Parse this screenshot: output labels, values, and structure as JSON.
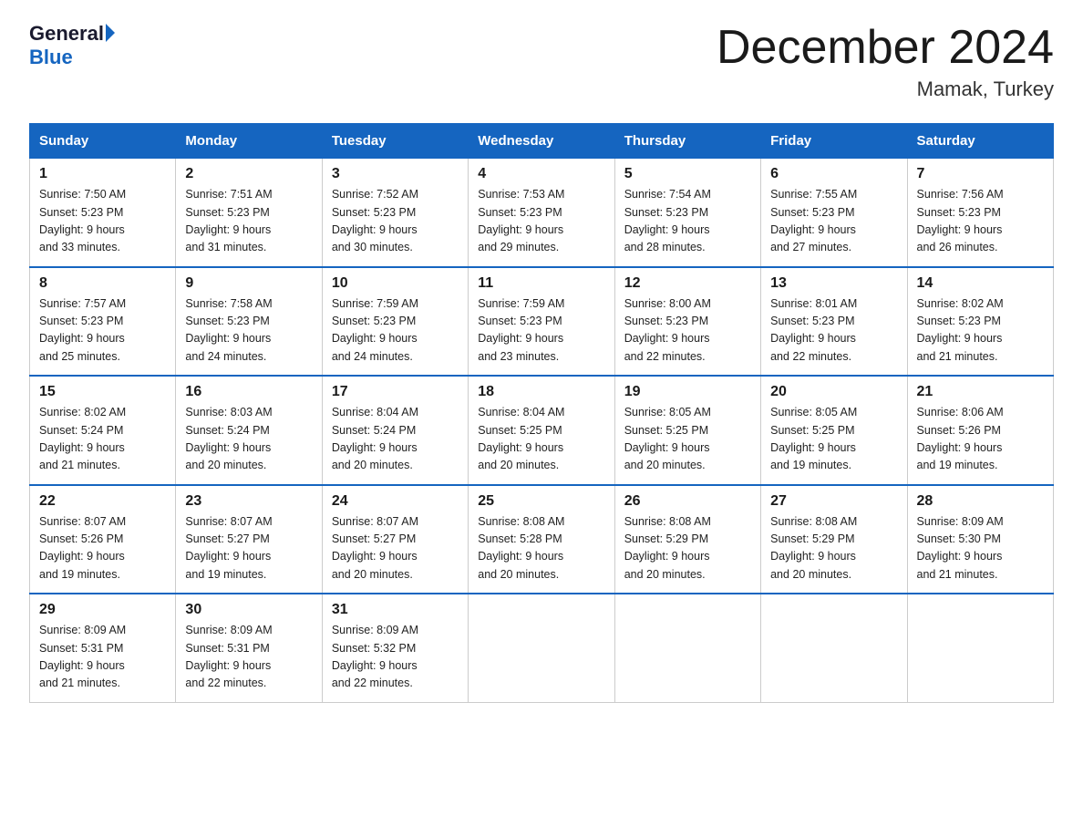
{
  "logo": {
    "line1": "General",
    "line2": "Blue"
  },
  "title": "December 2024",
  "subtitle": "Mamak, Turkey",
  "days_of_week": [
    "Sunday",
    "Monday",
    "Tuesday",
    "Wednesday",
    "Thursday",
    "Friday",
    "Saturday"
  ],
  "weeks": [
    [
      {
        "day": "1",
        "sunrise": "7:50 AM",
        "sunset": "5:23 PM",
        "daylight": "9 hours and 33 minutes."
      },
      {
        "day": "2",
        "sunrise": "7:51 AM",
        "sunset": "5:23 PM",
        "daylight": "9 hours and 31 minutes."
      },
      {
        "day": "3",
        "sunrise": "7:52 AM",
        "sunset": "5:23 PM",
        "daylight": "9 hours and 30 minutes."
      },
      {
        "day": "4",
        "sunrise": "7:53 AM",
        "sunset": "5:23 PM",
        "daylight": "9 hours and 29 minutes."
      },
      {
        "day": "5",
        "sunrise": "7:54 AM",
        "sunset": "5:23 PM",
        "daylight": "9 hours and 28 minutes."
      },
      {
        "day": "6",
        "sunrise": "7:55 AM",
        "sunset": "5:23 PM",
        "daylight": "9 hours and 27 minutes."
      },
      {
        "day": "7",
        "sunrise": "7:56 AM",
        "sunset": "5:23 PM",
        "daylight": "9 hours and 26 minutes."
      }
    ],
    [
      {
        "day": "8",
        "sunrise": "7:57 AM",
        "sunset": "5:23 PM",
        "daylight": "9 hours and 25 minutes."
      },
      {
        "day": "9",
        "sunrise": "7:58 AM",
        "sunset": "5:23 PM",
        "daylight": "9 hours and 24 minutes."
      },
      {
        "day": "10",
        "sunrise": "7:59 AM",
        "sunset": "5:23 PM",
        "daylight": "9 hours and 24 minutes."
      },
      {
        "day": "11",
        "sunrise": "7:59 AM",
        "sunset": "5:23 PM",
        "daylight": "9 hours and 23 minutes."
      },
      {
        "day": "12",
        "sunrise": "8:00 AM",
        "sunset": "5:23 PM",
        "daylight": "9 hours and 22 minutes."
      },
      {
        "day": "13",
        "sunrise": "8:01 AM",
        "sunset": "5:23 PM",
        "daylight": "9 hours and 22 minutes."
      },
      {
        "day": "14",
        "sunrise": "8:02 AM",
        "sunset": "5:23 PM",
        "daylight": "9 hours and 21 minutes."
      }
    ],
    [
      {
        "day": "15",
        "sunrise": "8:02 AM",
        "sunset": "5:24 PM",
        "daylight": "9 hours and 21 minutes."
      },
      {
        "day": "16",
        "sunrise": "8:03 AM",
        "sunset": "5:24 PM",
        "daylight": "9 hours and 20 minutes."
      },
      {
        "day": "17",
        "sunrise": "8:04 AM",
        "sunset": "5:24 PM",
        "daylight": "9 hours and 20 minutes."
      },
      {
        "day": "18",
        "sunrise": "8:04 AM",
        "sunset": "5:25 PM",
        "daylight": "9 hours and 20 minutes."
      },
      {
        "day": "19",
        "sunrise": "8:05 AM",
        "sunset": "5:25 PM",
        "daylight": "9 hours and 20 minutes."
      },
      {
        "day": "20",
        "sunrise": "8:05 AM",
        "sunset": "5:25 PM",
        "daylight": "9 hours and 19 minutes."
      },
      {
        "day": "21",
        "sunrise": "8:06 AM",
        "sunset": "5:26 PM",
        "daylight": "9 hours and 19 minutes."
      }
    ],
    [
      {
        "day": "22",
        "sunrise": "8:07 AM",
        "sunset": "5:26 PM",
        "daylight": "9 hours and 19 minutes."
      },
      {
        "day": "23",
        "sunrise": "8:07 AM",
        "sunset": "5:27 PM",
        "daylight": "9 hours and 19 minutes."
      },
      {
        "day": "24",
        "sunrise": "8:07 AM",
        "sunset": "5:27 PM",
        "daylight": "9 hours and 20 minutes."
      },
      {
        "day": "25",
        "sunrise": "8:08 AM",
        "sunset": "5:28 PM",
        "daylight": "9 hours and 20 minutes."
      },
      {
        "day": "26",
        "sunrise": "8:08 AM",
        "sunset": "5:29 PM",
        "daylight": "9 hours and 20 minutes."
      },
      {
        "day": "27",
        "sunrise": "8:08 AM",
        "sunset": "5:29 PM",
        "daylight": "9 hours and 20 minutes."
      },
      {
        "day": "28",
        "sunrise": "8:09 AM",
        "sunset": "5:30 PM",
        "daylight": "9 hours and 21 minutes."
      }
    ],
    [
      {
        "day": "29",
        "sunrise": "8:09 AM",
        "sunset": "5:31 PM",
        "daylight": "9 hours and 21 minutes."
      },
      {
        "day": "30",
        "sunrise": "8:09 AM",
        "sunset": "5:31 PM",
        "daylight": "9 hours and 22 minutes."
      },
      {
        "day": "31",
        "sunrise": "8:09 AM",
        "sunset": "5:32 PM",
        "daylight": "9 hours and 22 minutes."
      },
      null,
      null,
      null,
      null
    ]
  ]
}
